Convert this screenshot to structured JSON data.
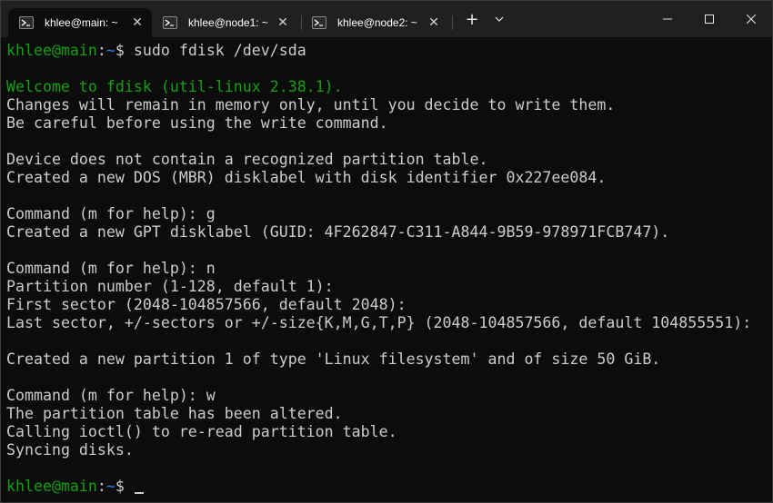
{
  "tabs": [
    {
      "label": "khlee@main: ~",
      "active": true
    },
    {
      "label": "khlee@node1: ~",
      "active": false
    },
    {
      "label": "khlee@node2: ~",
      "active": false
    }
  ],
  "titlebar": {
    "new_tab_glyph": "+",
    "dropdown_glyph": "⌄",
    "minimize_glyph": "—",
    "maximize_glyph": "☐",
    "close_glyph": "✕",
    "tab_close_glyph": "✕"
  },
  "terminal": {
    "prompt_user": "khlee@main",
    "prompt_sep": ":",
    "prompt_path": "~",
    "prompt_sign": "$",
    "first_command": " sudo fdisk /dev/sda",
    "welcome": "Welcome to fdisk (util-linux 2.38.1).",
    "lines": [
      "Changes will remain in memory only, until you decide to write them.",
      "Be careful before using the write command.",
      "",
      "Device does not contain a recognized partition table.",
      "Created a new DOS (MBR) disklabel with disk identifier 0x227ee084.",
      "",
      "Command (m for help): g",
      "Created a new GPT disklabel (GUID: 4F262847-C311-A844-9B59-978971FCB747).",
      "",
      "Command (m for help): n",
      "Partition number (1-128, default 1):",
      "First sector (2048-104857566, default 2048):",
      "Last sector, +/-sectors or +/-size{K,M,G,T,P} (2048-104857566, default 104855551):",
      "",
      "Created a new partition 1 of type 'Linux filesystem' and of size 50 GiB.",
      "",
      "Command (m for help): w",
      "The partition table has been altered.",
      "Calling ioctl() to re-read partition table.",
      "Syncing disks.",
      ""
    ]
  },
  "colors": {
    "background": "#0c0c0c",
    "titlebar": "#202020",
    "foreground": "#cccccc",
    "green": "#13a10e",
    "blue": "#3b78ff"
  }
}
